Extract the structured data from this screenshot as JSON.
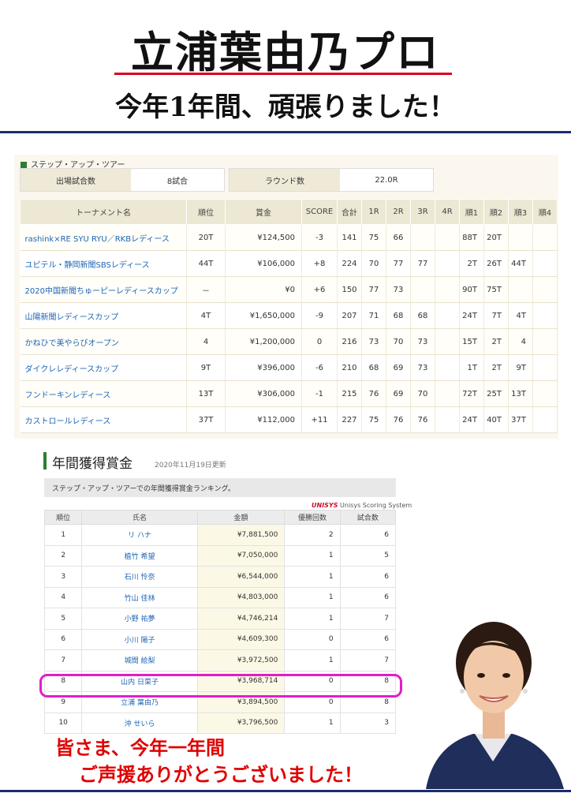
{
  "header": {
    "title": "立浦葉由乃プロ",
    "subtitle": "今年1年間、頑張りました！"
  },
  "tour": {
    "label": "ステップ・アップ・ツアー",
    "summary": [
      {
        "key": "出場試合数",
        "value": "8試合"
      },
      {
        "key": "ラウンド数",
        "value": "22.0R"
      }
    ],
    "columns": [
      "トーナメント名",
      "順位",
      "賞金",
      "SCORE",
      "合計",
      "1R",
      "2R",
      "3R",
      "4R",
      "順1",
      "順2",
      "順3",
      "順4"
    ],
    "rows": [
      [
        "rashink×RE SYU RYU／RKBレディース",
        "20T",
        "¥124,500",
        "-3",
        "141",
        "75",
        "66",
        "",
        "",
        "88T",
        "20T",
        "",
        ""
      ],
      [
        "ユピテル・静岡新聞SBSレディース",
        "44T",
        "¥106,000",
        "+8",
        "224",
        "70",
        "77",
        "77",
        "",
        "2T",
        "26T",
        "44T",
        ""
      ],
      [
        "2020中国新聞ちゅーピーレディースカップ",
        "－",
        "¥0",
        "+6",
        "150",
        "77",
        "73",
        "",
        "",
        "90T",
        "75T",
        "",
        ""
      ],
      [
        "山陽新聞レディースカップ",
        "4T",
        "¥1,650,000",
        "-9",
        "207",
        "71",
        "68",
        "68",
        "",
        "24T",
        "7T",
        "4T",
        ""
      ],
      [
        "かねひで美やらびオープン",
        "4",
        "¥1,200,000",
        "0",
        "216",
        "73",
        "70",
        "73",
        "",
        "15T",
        "2T",
        "4",
        ""
      ],
      [
        "ダイクレレディースカップ",
        "9T",
        "¥396,000",
        "-6",
        "210",
        "68",
        "69",
        "73",
        "",
        "1T",
        "2T",
        "9T",
        ""
      ],
      [
        "フンドーキンレディース",
        "13T",
        "¥306,000",
        "-1",
        "215",
        "76",
        "69",
        "70",
        "",
        "72T",
        "25T",
        "13T",
        ""
      ],
      [
        "カストロールレディース",
        "37T",
        "¥112,000",
        "+11",
        "227",
        "75",
        "76",
        "76",
        "",
        "24T",
        "40T",
        "37T",
        ""
      ]
    ]
  },
  "ranking": {
    "title": "年間獲得賞金",
    "updated": "2020年11月19日更新",
    "description": "ステップ・アップ・ツアーでの年間獲得賞金ランキング。",
    "sponsor_logo": "UNISYS",
    "sponsor_text": "Unisys Scoring System",
    "columns": [
      "順位",
      "氏名",
      "金額",
      "優勝回数",
      "試合数"
    ],
    "rows": [
      [
        "1",
        "リ ハナ",
        "¥7,881,500",
        "2",
        "6"
      ],
      [
        "2",
        "植竹 希望",
        "¥7,050,000",
        "1",
        "5"
      ],
      [
        "3",
        "石川 怜奈",
        "¥6,544,000",
        "1",
        "6"
      ],
      [
        "4",
        "竹山 佳林",
        "¥4,803,000",
        "1",
        "6"
      ],
      [
        "5",
        "小野 祐夢",
        "¥4,746,214",
        "1",
        "7"
      ],
      [
        "6",
        "小川 陽子",
        "¥4,609,300",
        "0",
        "6"
      ],
      [
        "7",
        "城間 絵梨",
        "¥3,972,500",
        "1",
        "7"
      ],
      [
        "8",
        "山内 日菜子",
        "¥3,968,714",
        "0",
        "8"
      ],
      [
        "9",
        "立浦 葉由乃",
        "¥3,894,500",
        "0",
        "8"
      ],
      [
        "10",
        "沖 せいら",
        "¥3,796,500",
        "1",
        "3"
      ]
    ]
  },
  "thanks": {
    "line1": "皆さま、今年一年間",
    "line2": "ご声援ありがとうございました！"
  },
  "colors": {
    "accent_red": "#e00000",
    "navy": "#1b2c6e",
    "highlight": "#e11ec9",
    "link_blue": "#1e64b4"
  }
}
